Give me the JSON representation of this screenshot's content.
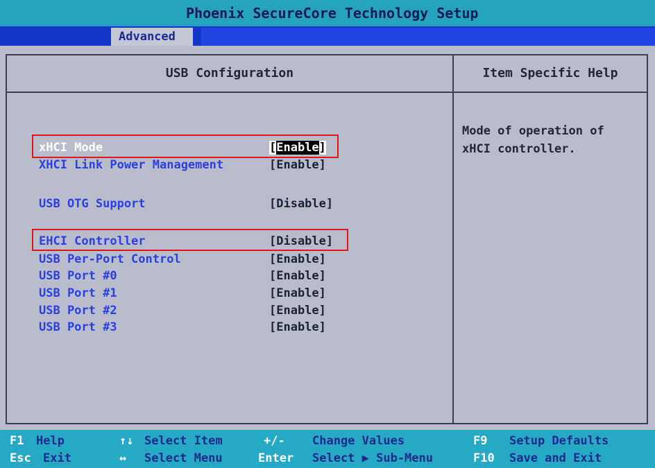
{
  "title": "Phoenix SecureCore Technology Setup",
  "menu": {
    "active_tab": "Advanced"
  },
  "left_panel": {
    "title": "USB Configuration",
    "items": [
      {
        "label": "xHCI Mode",
        "value": "[Enable]",
        "selected": true,
        "highlighted": true
      },
      {
        "label": "XHCI Link Power Management",
        "value": "[Enable]"
      },
      {
        "label": "USB OTG Support",
        "value": "[Disable]"
      },
      {
        "label": "EHCI Controller",
        "value": "[Disable]",
        "highlighted": true
      },
      {
        "label": "USB Per-Port Control",
        "value": "[Enable]"
      },
      {
        "label": "USB Port #0",
        "value": "[Enable]"
      },
      {
        "label": "USB Port #1",
        "value": "[Enable]"
      },
      {
        "label": "USB Port #2",
        "value": "[Enable]"
      },
      {
        "label": "USB Port #3",
        "value": "[Enable]"
      }
    ]
  },
  "right_panel": {
    "title": "Item Specific Help",
    "help_text": "Mode of operation of\nxHCI controller."
  },
  "footer": {
    "row1": [
      {
        "key": "F1",
        "desc": "Help"
      },
      {
        "key": "↑↓",
        "desc": "Select Item"
      },
      {
        "key": "+/-",
        "desc": "Change Values"
      },
      {
        "key": "F9",
        "desc": "Setup Defaults"
      }
    ],
    "row2": [
      {
        "key": "Esc",
        "desc": "Exit"
      },
      {
        "key": "↔",
        "desc": "Select Menu"
      },
      {
        "key": "Enter",
        "desc": "Select ▶ Sub-Menu"
      },
      {
        "key": "F10",
        "desc": "Save and Exit"
      }
    ]
  },
  "colors": {
    "title_bar": "#26a3bf",
    "menu_bar": "#1437c9",
    "panel_bg": "#b9bccb",
    "item_label": "#2a3fe6",
    "highlight_box": "#e01717",
    "key_bar": "#25a9c4"
  }
}
